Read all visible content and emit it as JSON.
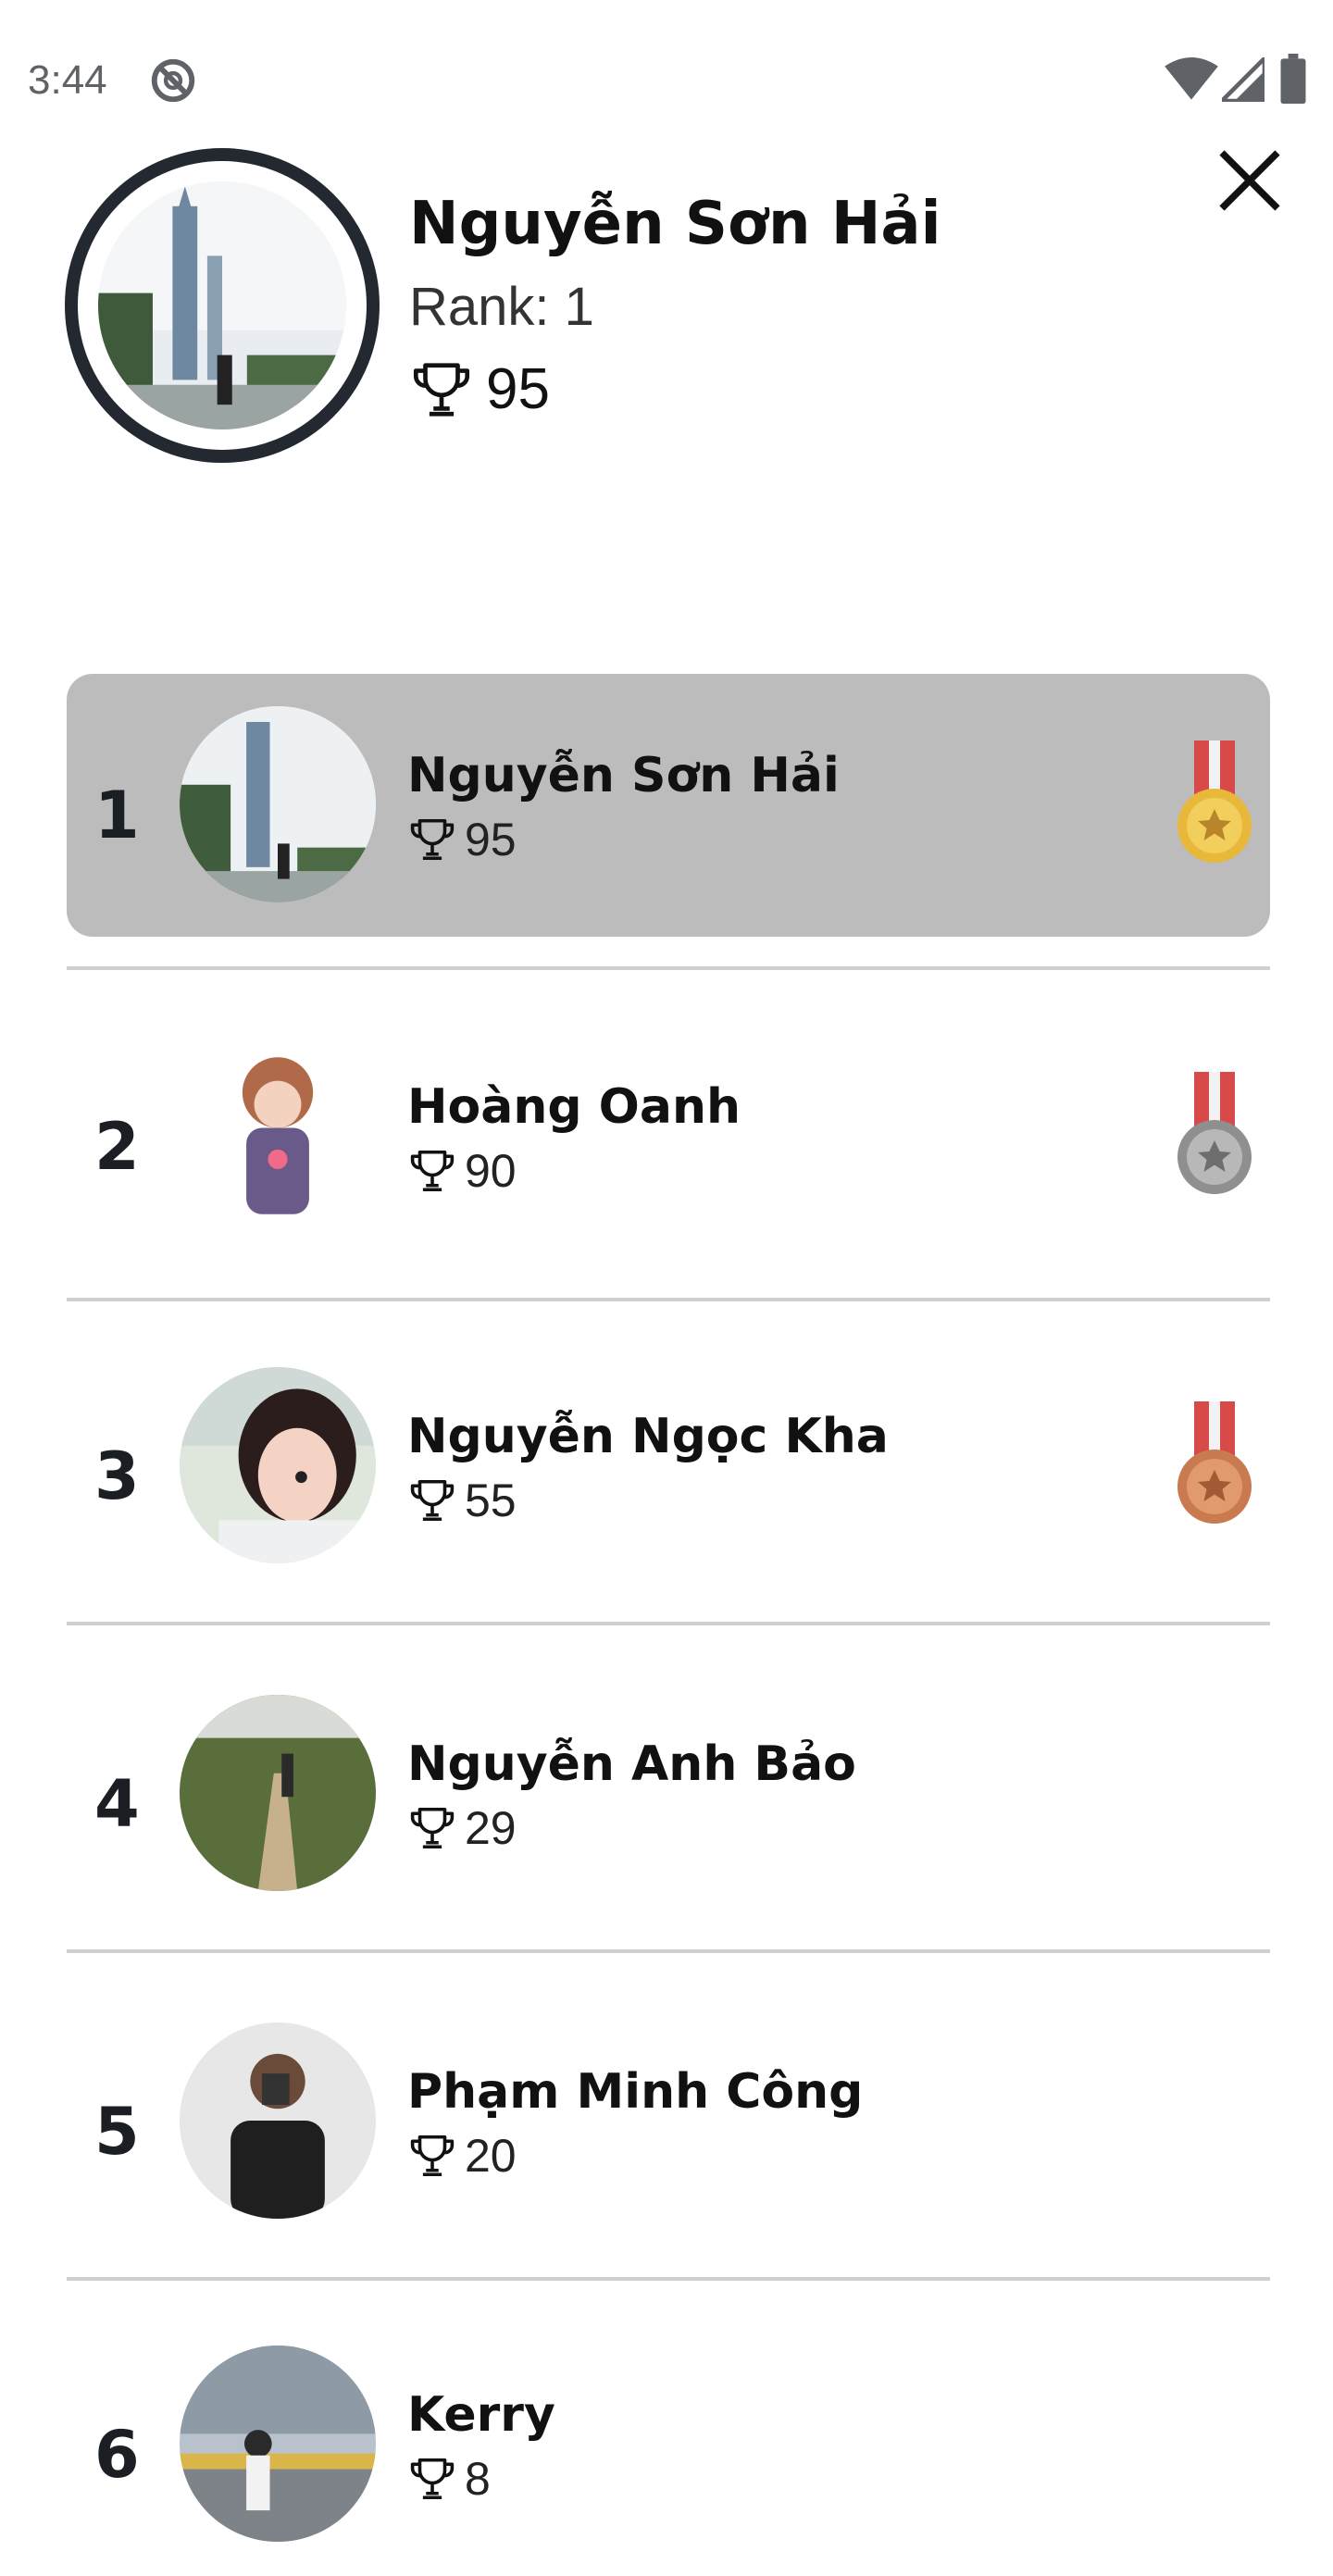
{
  "status": {
    "time": "3:44"
  },
  "profile": {
    "name": "Nguyễn Sơn Hải",
    "rank_text": "Rank: 1",
    "score": "95"
  },
  "leaderboard": [
    {
      "rank": "1",
      "name": "Nguyễn Sơn Hải",
      "score": "95",
      "medal": "gold-medal"
    },
    {
      "rank": "2",
      "name": "Hoàng Oanh",
      "score": "90",
      "medal": "silver-medal"
    },
    {
      "rank": "3",
      "name": "Nguyễn Ngọc Kha",
      "score": "55",
      "medal": "bronze-medal"
    },
    {
      "rank": "4",
      "name": "Nguyễn Anh Bảo",
      "score": "29"
    },
    {
      "rank": "5",
      "name": "Phạm Minh Công",
      "score": "20"
    },
    {
      "rank": "6",
      "name": "Kerry",
      "score": "8"
    }
  ],
  "colors": {
    "highlight_row": "#bcbcbc",
    "profile_ring": "#232831",
    "gold": "#e8b83a",
    "silver": "#9a9a9a",
    "bronze": "#c97a4e",
    "ribbon": "#d84a4a"
  },
  "icons": [
    "do-not-disturb-icon",
    "wifi-icon",
    "signal-icon",
    "battery-icon",
    "close-icon",
    "trophy-icon"
  ]
}
